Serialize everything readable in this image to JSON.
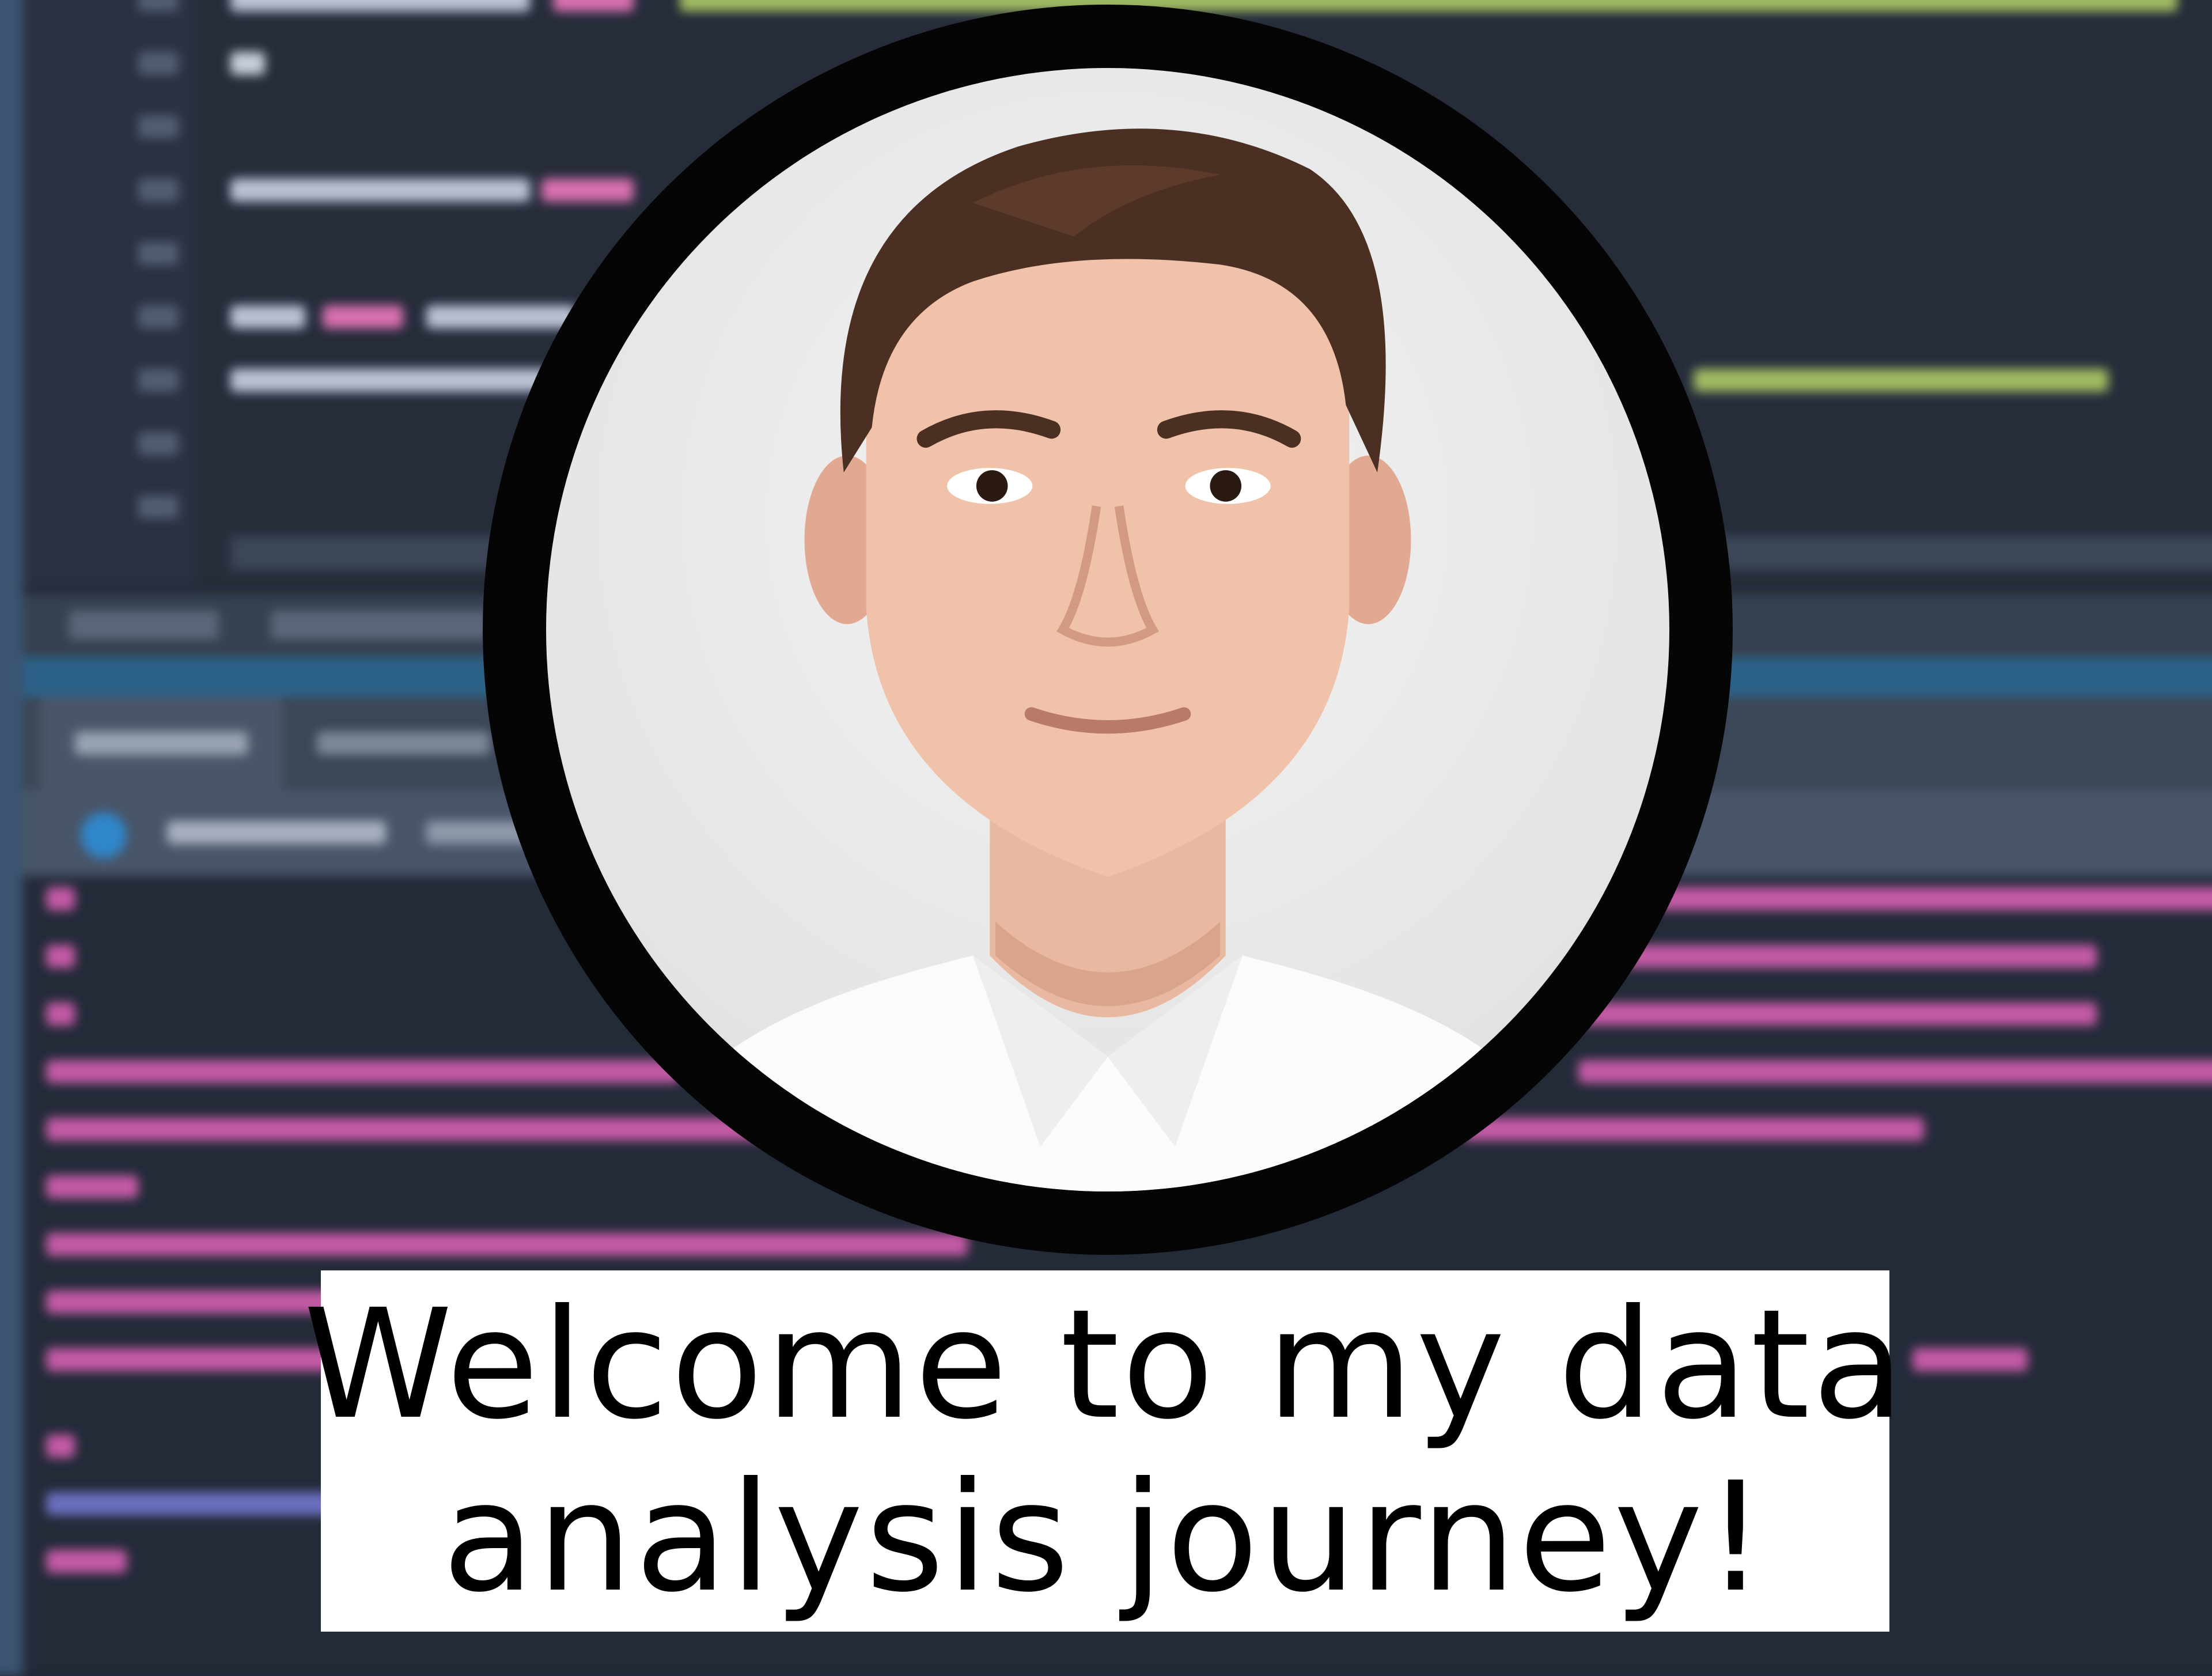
{
  "caption": {
    "line1": "Welcome to my data",
    "line2": "analysis journey!"
  },
  "colors": {
    "background": "#1f2633",
    "ring": "#050505",
    "caption_bg": "#ffffff",
    "caption_text": "#000000"
  },
  "background_icons": [
    "run-console-icon"
  ]
}
